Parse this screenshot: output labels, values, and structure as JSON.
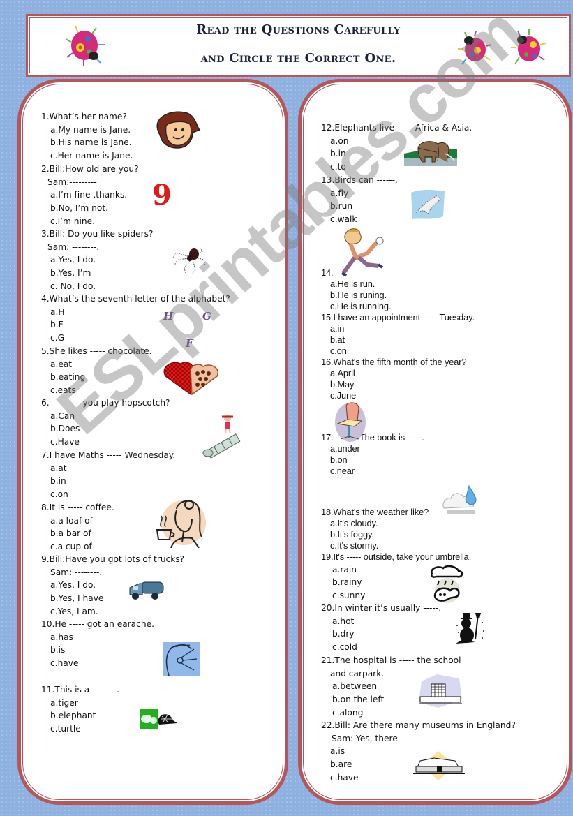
{
  "header": {
    "line1": "Read the Questions Carefully",
    "line2": "and Circle the Correct One."
  },
  "watermark": "ESLprintables.com",
  "left_questions": [
    {
      "stem": "1.What’s her name?",
      "options": [
        "a.My name is Jane.",
        "b.His name is Jane.",
        "c.Her name is Jane."
      ],
      "picture": "girl-face-icon"
    },
    {
      "stem": "2.Bill:How old are you?",
      "sub": "Sam:---------",
      "options": [
        "a.I’m fine ,thanks.",
        "b.No, I’m not.",
        "c.I’m nine."
      ],
      "picture": "number-nine-icon",
      "picture_text": "9"
    },
    {
      "stem": "3.Bill: Do you like spiders?",
      "sub": "Sam: --------.",
      "options": [
        "a.Yes, I do.",
        "b.Yes, I’m",
        "c. No, I do."
      ],
      "picture": "spider-icon"
    },
    {
      "stem": "4.What’s the seventh letter of the alphabet?",
      "options": [
        "a.H",
        "b.F",
        "c.G"
      ],
      "picture": "letters-icon",
      "letters": [
        "H",
        "G",
        "F"
      ]
    },
    {
      "stem": "5.She likes ----- chocolate.",
      "options": [
        "a.eat",
        "b.eating",
        "c.eats"
      ],
      "picture": "chocolate-box-icon"
    },
    {
      "stem": "6.---------- you play hopscotch?",
      "options": [
        "a.Can",
        "b.Does",
        "c.Have"
      ],
      "picture": "hopscotch-icon"
    },
    {
      "stem": "7.I have Maths ----- Wednesday.",
      "options": [
        "a.at",
        "b.in",
        "c.on"
      ]
    },
    {
      "stem": "8.It is ----- coffee.",
      "options": [
        "a.a loaf of",
        "b.a bar of",
        "c.a cup of"
      ],
      "picture": "woman-coffee-icon"
    },
    {
      "stem": "9.Bill:Have you got lots of trucks?",
      "sub": "Sam: --------.",
      "options": [
        "a.Yes, I do.",
        "b.Yes, I have",
        "c.Yes, I am."
      ],
      "picture": "truck-icon"
    },
    {
      "stem": "10.He ----- got an earache.",
      "options": [
        "a.has",
        "b.is",
        "c.have"
      ],
      "picture": "earache-icon"
    },
    {
      "stem": "11.This is a --------.",
      "options": [
        "a.tiger",
        "b.elephant",
        "c.turtle"
      ],
      "picture": "turtle-icon"
    }
  ],
  "right_questions": [
    {
      "stem": "12.Elephants live ----- Africa & Asia.",
      "options": [
        "a.on",
        "b.in",
        "c.to"
      ],
      "picture": "elephant-icon"
    },
    {
      "stem": "13.Birds can ------.",
      "options": [
        "a.fly",
        "b.run",
        "c.walk"
      ],
      "picture": "bird-icon"
    },
    {
      "stem": "14.",
      "options": [
        "a.He is run.",
        "b.He is runing.",
        "c.He is running."
      ],
      "picture": "running-boy-icon"
    },
    {
      "stem": "15.I have an appointment ----- Tuesday.",
      "options": [
        "a.in",
        "b.at",
        "c.on"
      ]
    },
    {
      "stem": "16.What's the fifth month of the year?",
      "options": [
        "a.April",
        "b.May",
        "c.June"
      ]
    },
    {
      "stem": "17.",
      "stem_tail": "The book is -----.",
      "options": [
        "a.under",
        "b.on",
        "c.near"
      ],
      "picture": "book-on-chair-icon"
    },
    {
      "stem": "18.What's the weather like?",
      "options": [
        "a.It's cloudy.",
        "b.It's foggy.",
        "c.It's stormy."
      ],
      "picture": "rain-cloud-icon"
    },
    {
      "stem": "19.It's ----- outside, take your umbrella.",
      "options": [
        "a.rain",
        "b.rainy",
        "c.sunny"
      ],
      "picture": "rainy-cloud-icon"
    },
    {
      "stem": "20.In winter it’s usually -----.",
      "options": [
        "a.hot",
        "b.dry",
        "c.cold"
      ],
      "picture": "snowman-icon"
    },
    {
      "stem": "21.The hospital is ----- the school",
      "sub": "and carpark.",
      "options": [
        "a.between",
        "b.on the left",
        "c.along"
      ],
      "picture": "hospital-icon"
    },
    {
      "stem": "22.Bill: Are there many museums in England?",
      "sub": "Sam: Yes, there -----",
      "options": [
        "a.is",
        "b.are",
        "c.have"
      ],
      "picture": "museum-icon"
    }
  ],
  "colors": {
    "background": "#8fb1e0",
    "border": "#b85558",
    "title": "#1a2436"
  }
}
